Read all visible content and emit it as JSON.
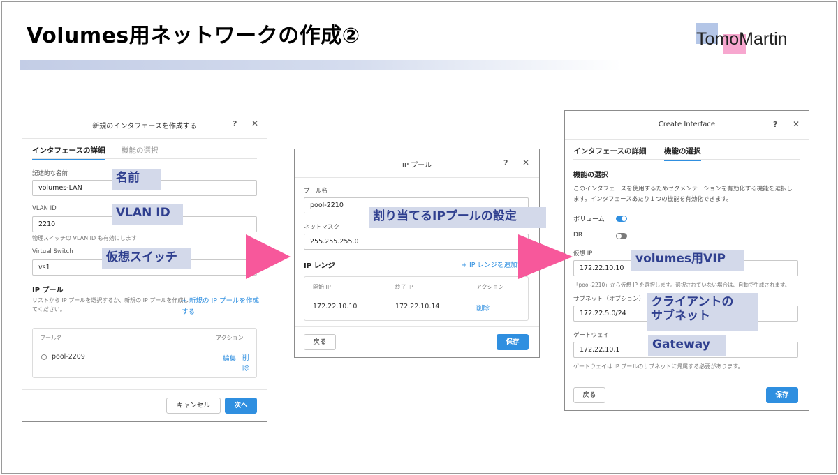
{
  "slide": {
    "title": "Volumes用ネットワークの作成②",
    "logo_text": "TomoMartin"
  },
  "dialog1": {
    "title": "新規のインタフェースを作成する",
    "help": "?",
    "close": "✕",
    "tabs": [
      "インタフェースの詳細",
      "機能の選択"
    ],
    "name_label": "記述的な名前",
    "name_value": "volumes-LAN",
    "vlan_label": "VLAN ID",
    "vlan_value": "2210",
    "vlan_help": "物理スイッチの VLAN ID も有効にします",
    "vswitch_label": "Virtual Switch",
    "vswitch_value": "vs1",
    "pool_section": "IP プール",
    "pool_desc_1": "リストから IP プールを選択するか、新規の IP プールを作成し",
    "pool_desc_2": "てください。",
    "new_pool_link_1": "+ 新規の IP プールを作成",
    "new_pool_link_2": "する",
    "table_headers": [
      "プール名",
      "アクション"
    ],
    "table_row": {
      "name": "pool-2209",
      "edit": "編集",
      "delete_1": "削",
      "delete_2": "除"
    },
    "cancel_button": "キャンセル",
    "next_button": "次へ"
  },
  "dialog2": {
    "title": "IP プール",
    "help": "?",
    "close": "✕",
    "pool_name_label": "プール名",
    "pool_name_value": "pool-2210",
    "netmask_label": "ネットマスク",
    "netmask_value": "255.255.255.0",
    "range_section": "IP レンジ",
    "add_range_link": "+  IP レンジを追加する",
    "table_headers": [
      "開始 IP",
      "終了 IP",
      "アクション"
    ],
    "table_row": {
      "start": "172.22.10.10",
      "end": "172.22.10.14",
      "action": "削除"
    },
    "back_button": "戻る",
    "save_button": "保存"
  },
  "dialog3": {
    "title": "Create Interface",
    "help": "?",
    "close": "✕",
    "tabs": [
      "インタフェースの詳細",
      "機能の選択"
    ],
    "section": "機能の選択",
    "desc_1": "このインタフェースを使用するためセグメンテーションを有効化する機能を選択し",
    "desc_2": "ます。インタフェースあたり１つの機能を有効化できます。",
    "feature_volume": "ボリューム",
    "feature_volume_on": true,
    "feature_dr": "DR",
    "feature_dr_on": false,
    "vip_label": "仮想 IP",
    "vip_value": "172.22.10.10",
    "vip_help": "「pool-2210」から仮想 IP を選択します。選択されていない場合は、自動で生成されます。",
    "subnet_label": "サブネット（オプション）",
    "subnet_value": "172.22.5.0/24",
    "gateway_label": "ゲートウェイ",
    "gateway_value": "172.22.10.1",
    "gateway_help": "ゲートウェイは IP プールのサブネットに帰属する必要があります。",
    "back_button": "戻る",
    "save_button": "保存"
  },
  "callouts": {
    "name": "名前",
    "vlan": "VLAN ID",
    "vswitch": "仮想スイッチ",
    "ip_pool": "割り当てるIPプールの設定",
    "vip": "volumes用VIP",
    "client_subnet_1": "クライアントの",
    "client_subnet_2": "サブネット",
    "gateway": "Gateway"
  },
  "colors": {
    "accent": "#2f8fe0",
    "callout_bg": "#d3d9ea",
    "callout_text": "#2f3f8f",
    "arrow": "#f7589b"
  }
}
